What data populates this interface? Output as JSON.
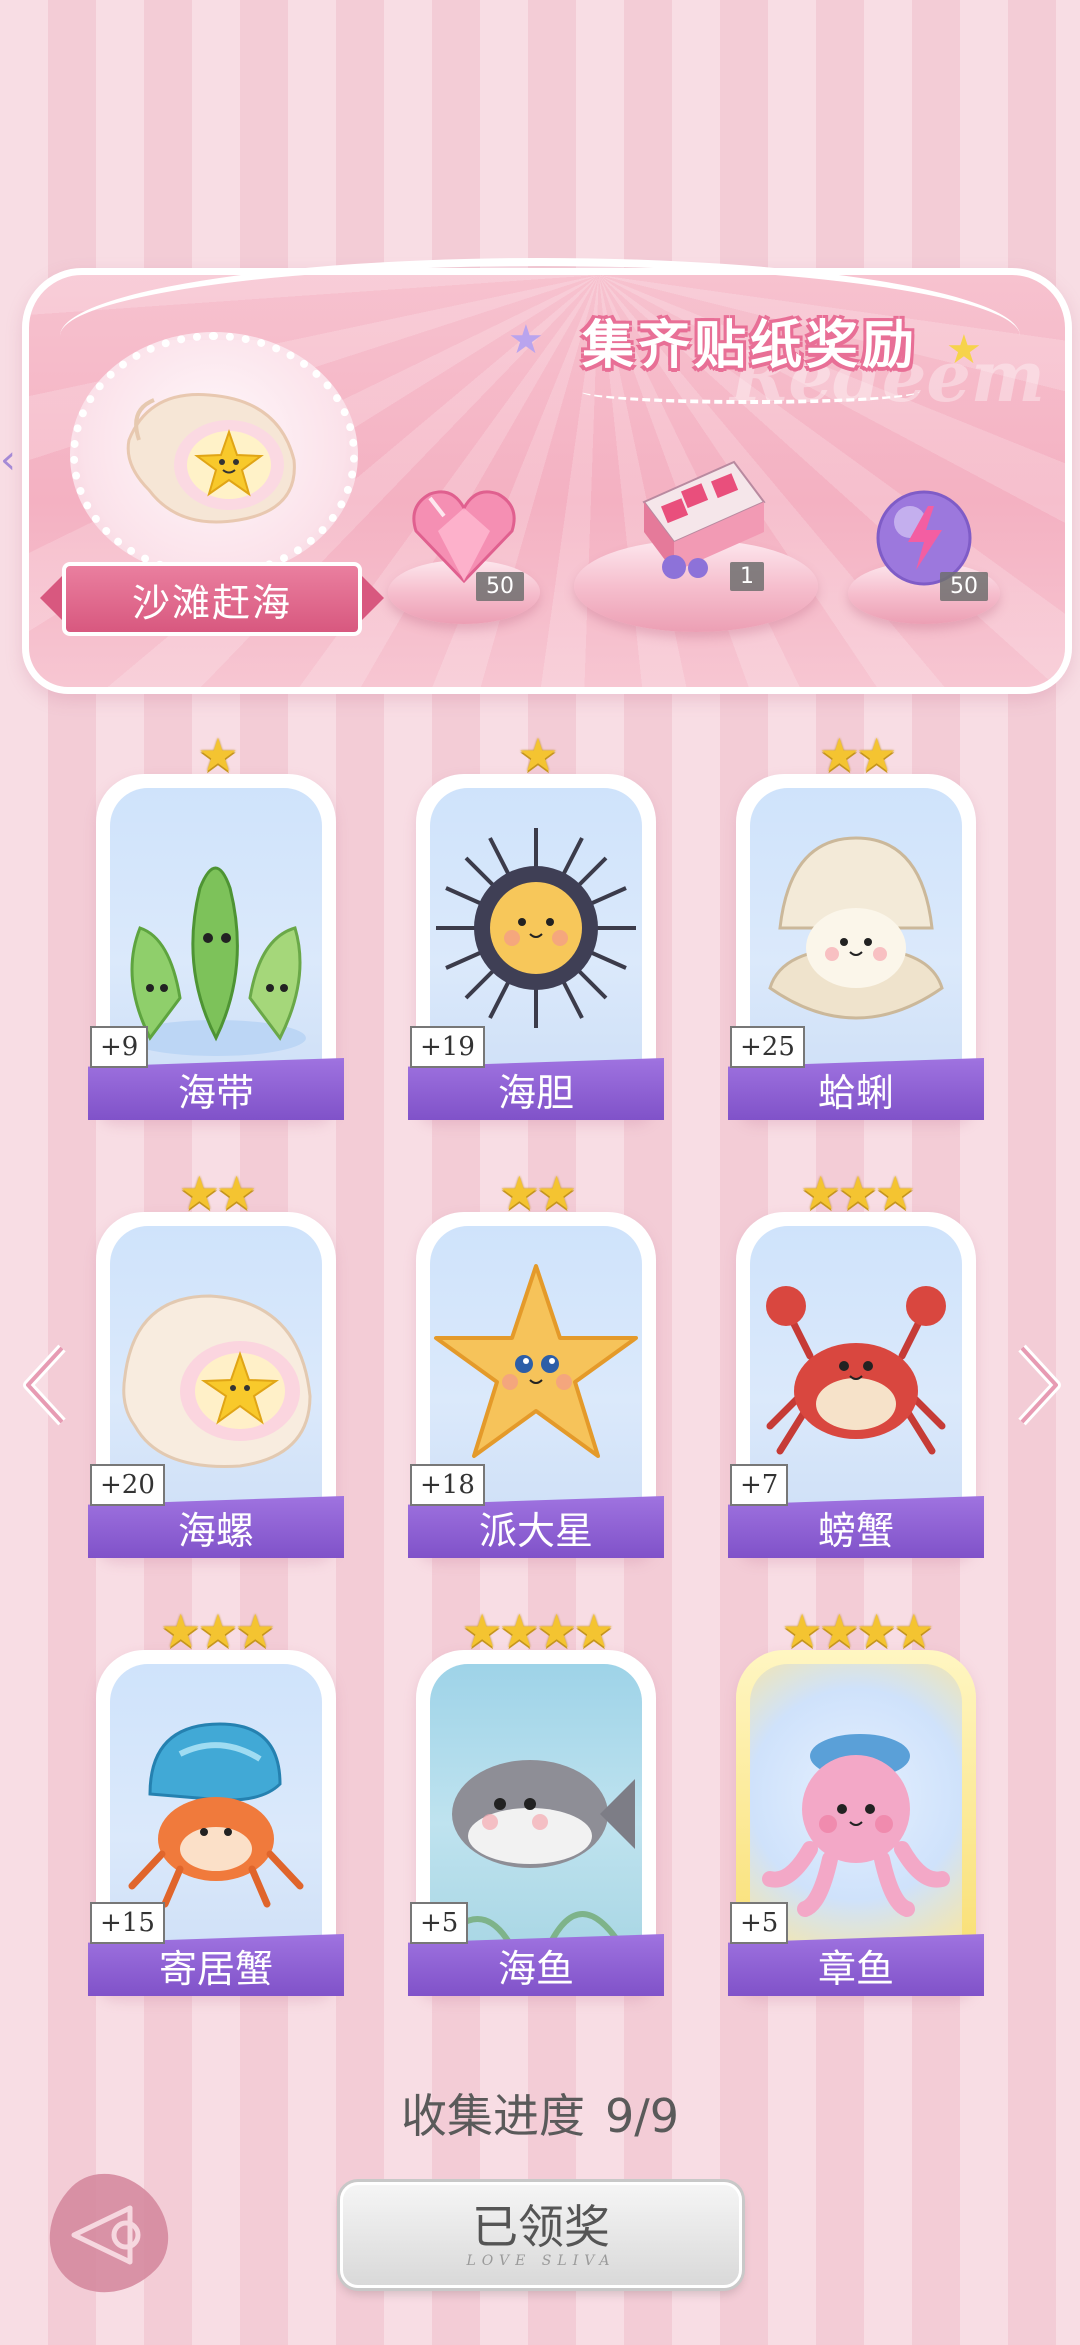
{
  "banner": {
    "title": "集齐贴纸奖励",
    "watermark": "Redeem",
    "theme_name": "沙滩赶海",
    "rewards": [
      {
        "icon": "pink-heart-gem-icon",
        "count": "50"
      },
      {
        "icon": "gift-box-icon",
        "count": "1"
      },
      {
        "icon": "energy-orb-icon",
        "count": "50"
      }
    ]
  },
  "cards": [
    {
      "name": "海带",
      "count": "+9",
      "stars": "★",
      "icon": "seaweed-icon"
    },
    {
      "name": "海胆",
      "count": "+19",
      "stars": "★",
      "icon": "sea-urchin-icon"
    },
    {
      "name": "蛤蜊",
      "count": "+25",
      "stars": "★★",
      "icon": "clam-icon"
    },
    {
      "name": "海螺",
      "count": "+20",
      "stars": "★★",
      "icon": "conch-shell-icon"
    },
    {
      "name": "派大星",
      "count": "+18",
      "stars": "★★",
      "icon": "starfish-icon"
    },
    {
      "name": "螃蟹",
      "count": "+7",
      "stars": "★★★",
      "icon": "crab-icon"
    },
    {
      "name": "寄居蟹",
      "count": "+15",
      "stars": "★★★",
      "icon": "hermit-crab-icon"
    },
    {
      "name": "海鱼",
      "count": "+5",
      "stars": "★★★★",
      "icon": "fish-icon"
    },
    {
      "name": "章鱼",
      "count": "+5",
      "stars": "★★★★",
      "icon": "octopus-icon"
    }
  ],
  "footer": {
    "progress_label": "收集进度",
    "progress_value": "9/9",
    "claimed_label": "已领奖",
    "claimed_sub": "LOVE SLIVA"
  },
  "colors": {
    "accent_pink": "#e86f96",
    "label_purple": "#8a5bd0",
    "star_gold": "#f4c431"
  }
}
